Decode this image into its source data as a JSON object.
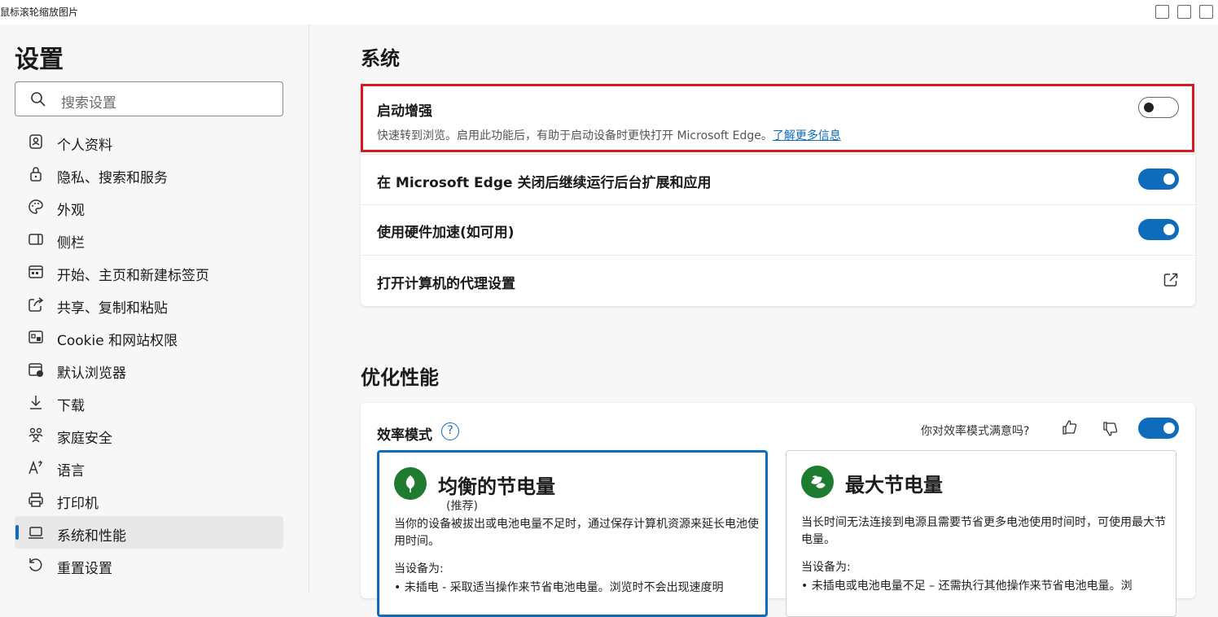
{
  "window": {
    "title": "鼠标滚轮缩放图片"
  },
  "sidebar": {
    "title": "设置",
    "search_placeholder": "搜索设置",
    "items": [
      {
        "label": "个人资料",
        "icon": "profile-icon"
      },
      {
        "label": "隐私、搜索和服务",
        "icon": "lock-icon"
      },
      {
        "label": "外观",
        "icon": "palette-icon"
      },
      {
        "label": "侧栏",
        "icon": "sidebar-icon"
      },
      {
        "label": "开始、主页和新建标签页",
        "icon": "home-icon"
      },
      {
        "label": "共享、复制和粘贴",
        "icon": "share-icon"
      },
      {
        "label": "Cookie 和网站权限",
        "icon": "cookie-icon"
      },
      {
        "label": "默认浏览器",
        "icon": "browser-icon"
      },
      {
        "label": "下载",
        "icon": "download-icon"
      },
      {
        "label": "家庭安全",
        "icon": "family-icon"
      },
      {
        "label": "语言",
        "icon": "language-icon"
      },
      {
        "label": "打印机",
        "icon": "printer-icon"
      },
      {
        "label": "系统和性能",
        "icon": "laptop-icon",
        "active": true
      },
      {
        "label": "重置设置",
        "icon": "reset-icon"
      }
    ]
  },
  "system": {
    "heading": "系统",
    "startup_boost": {
      "title": "启动增强",
      "description": "快速转到浏览。启用此功能后，有助于启动设备时更快打开 Microsoft Edge。",
      "learn_more": "了解更多信息",
      "enabled": false
    },
    "background_apps": {
      "title": "在 Microsoft Edge 关闭后继续运行后台扩展和应用",
      "enabled": true
    },
    "hardware_accel": {
      "title": "使用硬件加速(如可用)",
      "enabled": true
    },
    "proxy": {
      "title": "打开计算机的代理设置"
    }
  },
  "performance": {
    "heading": "优化性能",
    "efficiency": {
      "title": "效率模式",
      "feedback_question": "你对效率模式满意吗?",
      "enabled": true
    },
    "modes": [
      {
        "title": "均衡的节电量",
        "subtitle": "(推荐)",
        "description": "当你的设备被拔出或电池电量不足时，通过保存计算机资源来延长电池使用时间。",
        "when_heading": "当设备为:",
        "bullet": "•   未插电 - 采取适当操作来节省电池电量。浏览时不会出现速度明",
        "selected": true
      },
      {
        "title": "最大节电量",
        "subtitle": "",
        "description": "当长时间无法连接到电源且需要节省更多电池使用时间时，可使用最大节电量。",
        "when_heading": "当设备为:",
        "bullet": "•   未插电或电池电量不足 – 还需执行其他操作来节省电池电量。浏",
        "selected": false
      }
    ]
  },
  "colors": {
    "accent": "#0f6cbd",
    "highlight_border": "#d6191e",
    "mode_icon": "#1f7b2f"
  }
}
